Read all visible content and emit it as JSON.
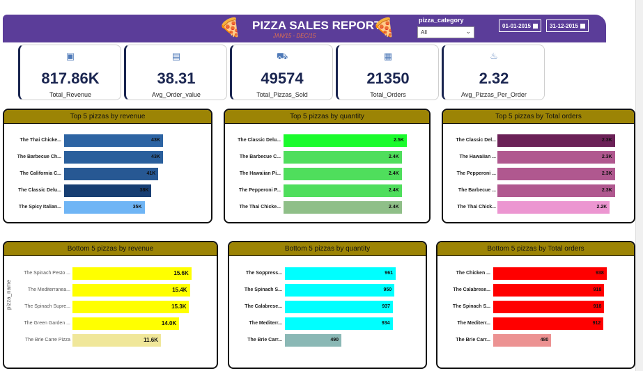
{
  "header": {
    "title": "PIZZA SALES REPORT",
    "subtitle": "JAN/15 - DEC/15",
    "filter_label": "pizza_category",
    "filter_value": "All",
    "date_start": "01-01-2015",
    "date_end": "31-12-2015",
    "background": "#5b3d99"
  },
  "kpis": [
    {
      "value": "817.86K",
      "label": "Total_Revenue",
      "icon": "money-icon"
    },
    {
      "value": "38.31",
      "label": "Avg_Order_value",
      "icon": "receipt-icon"
    },
    {
      "value": "49574",
      "label": "Total_Pizzas_Sold",
      "icon": "delivery-icon"
    },
    {
      "value": "21350",
      "label": "Total_Orders",
      "icon": "orders-icon"
    },
    {
      "value": "2.32",
      "label": "Avg_Pizzas_Per_Order",
      "icon": "chef-icon"
    }
  ],
  "chart_data": [
    {
      "type": "bar",
      "title": "Top 5 pizzas by revenue",
      "categories": [
        "The Thai Chicke...",
        "The Barbecue Ch...",
        "The California C...",
        "The Classic Delu...",
        "The Spicy Italian..."
      ],
      "values": [
        43,
        43,
        41,
        38,
        35
      ],
      "value_labels": [
        "43K",
        "43K",
        "41K",
        "38K",
        "35K"
      ],
      "colors": [
        "#2d64a3",
        "#2a5f9c",
        "#275893",
        "#173e72",
        "#6fb5f5"
      ],
      "xlim": [
        0,
        60
      ]
    },
    {
      "type": "bar",
      "title": "Top 5 pizzas by quantity",
      "categories": [
        "The Classic Delu...",
        "The Barbecue C...",
        "The Hawaiian Pi...",
        "The Pepperoni P...",
        "The Thai Chicke..."
      ],
      "values": [
        2.5,
        2.4,
        2.4,
        2.4,
        2.4
      ],
      "value_labels": [
        "2.5K",
        "2.4K",
        "2.4K",
        "2.4K",
        "2.4K"
      ],
      "colors": [
        "#1afb2c",
        "#4fde5c",
        "#4fde5c",
        "#4fde5c",
        "#8fbf88"
      ],
      "xlim": [
        0,
        2.8
      ]
    },
    {
      "type": "bar",
      "title": "Top 5 pizzas by Total orders",
      "categories": [
        "The Classic Del...",
        "The Hawaiian ...",
        "The Pepperoni ...",
        "The Barbecue ...",
        "The Thai Chick..."
      ],
      "values": [
        2.3,
        2.3,
        2.3,
        2.3,
        2.2
      ],
      "value_labels": [
        "2.3K",
        "2.3K",
        "2.3K",
        "2.3K",
        "2.2K"
      ],
      "colors": [
        "#6b2157",
        "#b0588f",
        "#b0588f",
        "#b0588f",
        "#ec96d1"
      ],
      "xlim": [
        0,
        2.4
      ]
    },
    {
      "type": "bar",
      "title": "Bottom 5 pizzas by revenue",
      "ylabel": "pizza_name",
      "categories": [
        "The Spinach Pesto ...",
        "The Mediterranea...",
        "The Spinach Supre...",
        "The Green Garden ...",
        "The Brie Carre Pizza"
      ],
      "values": [
        15.6,
        15.4,
        15.3,
        14.0,
        11.6
      ],
      "value_labels": [
        "15.6K",
        "15.4K",
        "15.3K",
        "14.0K",
        "11.6K"
      ],
      "colors": [
        "#ffff00",
        "#ffff00",
        "#ffff00",
        "#ffff00",
        "#f0e79a"
      ],
      "xlim": [
        0,
        16.9
      ]
    },
    {
      "type": "bar",
      "title": "Bottom 5 pizzas by quantity",
      "categories": [
        "The Soppress...",
        "The Spinach S...",
        "The Calabrese...",
        "The Mediterr...",
        "The Brie Carr..."
      ],
      "values": [
        961,
        950,
        937,
        934,
        490
      ],
      "value_labels": [
        "961",
        "950",
        "937",
        "934",
        "490"
      ],
      "colors": [
        "#00ffff",
        "#00ffff",
        "#00ffff",
        "#00ffff",
        "#8ab8b5"
      ],
      "xlim": [
        0,
        1088
      ]
    },
    {
      "type": "bar",
      "title": "Bottom 5 pizzas by Total orders",
      "categories": [
        "The Chicken ...",
        "The Calabrese...",
        "The Spinach S...",
        "The Mediterr...",
        "The Brie Carr..."
      ],
      "values": [
        938,
        918,
        918,
        912,
        480
      ],
      "value_labels": [
        "938",
        "918",
        "918",
        "912",
        "480"
      ],
      "colors": [
        "#ff0000",
        "#ff0000",
        "#ff0000",
        "#ff0000",
        "#ec9292"
      ],
      "xlim": [
        0,
        1037
      ]
    }
  ]
}
